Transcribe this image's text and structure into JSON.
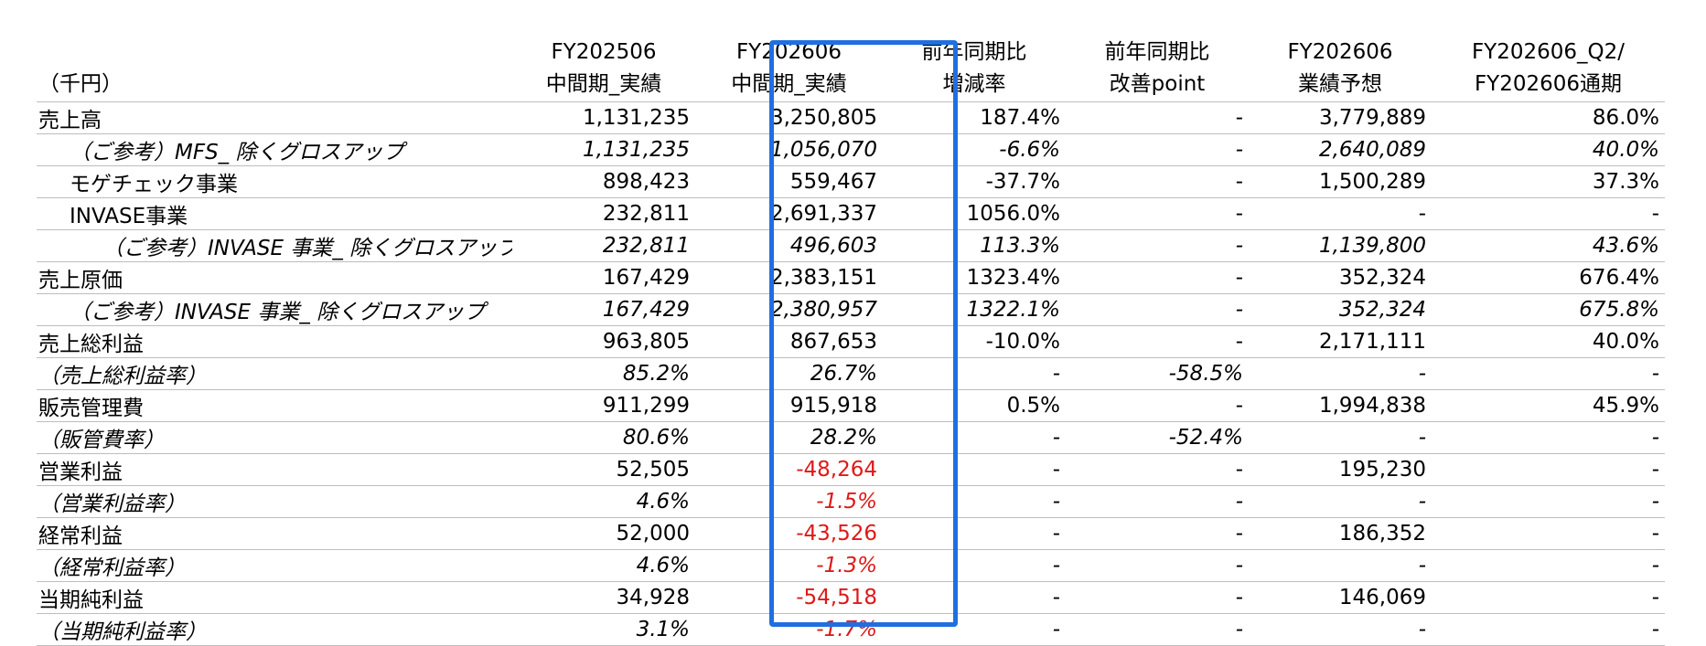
{
  "header": {
    "unit": "（千円）",
    "columns": [
      {
        "line1": "FY202506",
        "line2": "中間期_実績"
      },
      {
        "line1": "FY202606",
        "line2": "中間期_実績"
      },
      {
        "line1": "前年同期比",
        "line2": "増減率"
      },
      {
        "line1": "前年同期比",
        "line2": "改善point"
      },
      {
        "line1": "FY202606",
        "line2": "業績予想"
      },
      {
        "line1": "FY202606_Q2/",
        "line2": "FY202606通期"
      }
    ]
  },
  "rows": [
    {
      "label": "売上高",
      "indent": 0,
      "italic": false,
      "values": [
        "1,131,235",
        "3,250,805",
        "187.4%",
        "-",
        "3,779,889",
        "86.0%"
      ]
    },
    {
      "label": "（ご参考）MFS_ 除くグロスアップ",
      "indent": 1,
      "italic": true,
      "values": [
        "1,131,235",
        "1,056,070",
        "-6.6%",
        "-",
        "2,640,089",
        "40.0%"
      ]
    },
    {
      "label": "モゲチェック事業",
      "indent": 1,
      "italic": false,
      "values": [
        "898,423",
        "559,467",
        "-37.7%",
        "-",
        "1,500,289",
        "37.3%"
      ]
    },
    {
      "label": "INVASE事業",
      "indent": 1,
      "italic": false,
      "values": [
        "232,811",
        "2,691,337",
        "1056.0%",
        "-",
        "-",
        "-"
      ]
    },
    {
      "label": "（ご参考）INVASE 事業_ 除くグロスアップ",
      "indent": 2,
      "italic": true,
      "values": [
        "232,811",
        "496,603",
        "113.3%",
        "-",
        "1,139,800",
        "43.6%"
      ]
    },
    {
      "label": "売上原価",
      "indent": 0,
      "italic": false,
      "values": [
        "167,429",
        "2,383,151",
        "1323.4%",
        "-",
        "352,324",
        "676.4%"
      ]
    },
    {
      "label": "（ご参考）INVASE 事業_ 除くグロスアップ",
      "indent": 1,
      "italic": true,
      "values": [
        "167,429",
        "2,380,957",
        "1322.1%",
        "-",
        "352,324",
        "675.8%"
      ]
    },
    {
      "label": "売上総利益",
      "indent": 0,
      "italic": false,
      "values": [
        "963,805",
        "867,653",
        "-10.0%",
        "-",
        "2,171,111",
        "40.0%"
      ]
    },
    {
      "label": "（売上総利益率）",
      "indent": 0,
      "italic": true,
      "values": [
        "85.2%",
        "26.7%",
        "-",
        "-58.5%",
        "-",
        "-"
      ]
    },
    {
      "label": "販売管理費",
      "indent": 0,
      "italic": false,
      "values": [
        "911,299",
        "915,918",
        "0.5%",
        "-",
        "1,994,838",
        "45.9%"
      ]
    },
    {
      "label": "（販管費率）",
      "indent": 0,
      "italic": true,
      "values": [
        "80.6%",
        "28.2%",
        "-",
        "-52.4%",
        "-",
        "-"
      ]
    },
    {
      "label": "営業利益",
      "indent": 0,
      "italic": false,
      "values": [
        "52,505",
        "-48,264",
        "-",
        "-",
        "195,230",
        "-"
      ]
    },
    {
      "label": "（営業利益率）",
      "indent": 0,
      "italic": true,
      "values": [
        "4.6%",
        "-1.5%",
        "-",
        "-",
        "-",
        "-"
      ]
    },
    {
      "label": "経常利益",
      "indent": 0,
      "italic": false,
      "values": [
        "52,000",
        "-43,526",
        "-",
        "-",
        "186,352",
        "-"
      ]
    },
    {
      "label": "（経常利益率）",
      "indent": 0,
      "italic": true,
      "values": [
        "4.6%",
        "-1.3%",
        "-",
        "-",
        "-",
        "-"
      ]
    },
    {
      "label": "当期純利益",
      "indent": 0,
      "italic": false,
      "values": [
        "34,928",
        "-54,518",
        "-",
        "-",
        "146,069",
        "-"
      ]
    },
    {
      "label": "（当期純利益率）",
      "indent": 0,
      "italic": true,
      "values": [
        "3.1%",
        "-1.7%",
        "-",
        "-",
        "-",
        "-"
      ]
    }
  ],
  "highlight": {
    "column_index": 1,
    "color": "#1f6fe0"
  },
  "colors": {
    "negative_value": "#e01818",
    "gridline": "#bdbdbd",
    "text": "#000000"
  }
}
